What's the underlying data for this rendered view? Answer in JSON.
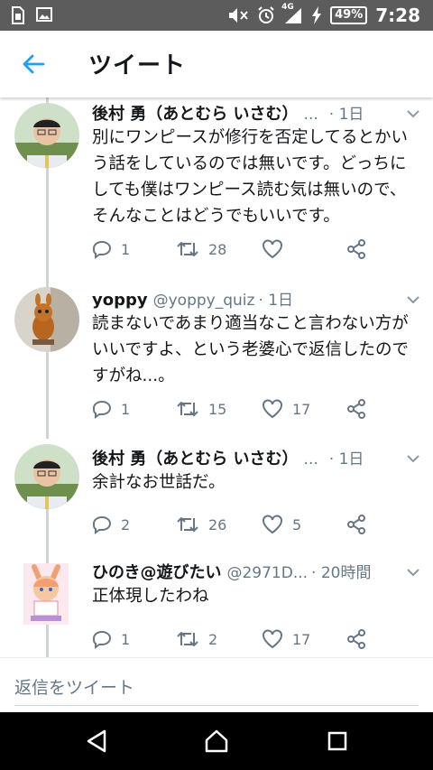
{
  "status_bar": {
    "icons": [
      "sim-card-icon",
      "image-icon",
      "mute-icon",
      "alarm-icon",
      "4g-signal-icon",
      "charging-icon"
    ],
    "network": "4G",
    "battery": "49%",
    "time": "7:28"
  },
  "header": {
    "title": "ツイート"
  },
  "tweets": [
    {
      "name": "後村 勇（あとむら いさむ）",
      "handle": "...",
      "time": "· 1日",
      "text": "別にワンピースが修行を否定してるとかいう話をしているのでは無いです。どっちにしても僕はワンピース読む気は無いので、そんなことはどうでもいいです。",
      "replies": "1",
      "retweets": "28",
      "likes": ""
    },
    {
      "name": "yoppy",
      "handle": "@yoppy_quiz",
      "time": "· 1日",
      "text": "読まないであまり適当なこと言わない方がいいですよ、という老婆心で返信したのですがね...。",
      "replies": "1",
      "retweets": "15",
      "likes": "17"
    },
    {
      "name": "後村 勇（あとむら いさむ）",
      "handle": "...",
      "time": "· 1日",
      "text": "余計なお世話だ。",
      "replies": "2",
      "retweets": "26",
      "likes": "5"
    },
    {
      "name": "ひのき@遊びたい",
      "handle": "@2971D...",
      "time": "· 20時間",
      "text": "正体現したわね",
      "replies": "1",
      "retweets": "2",
      "likes": "17"
    }
  ],
  "reply_bar": {
    "placeholder": "返信をツイート"
  },
  "colors": {
    "accent": "#1da1f2",
    "secondary_text": "#657786",
    "status_bar": "#5c5c5c"
  }
}
